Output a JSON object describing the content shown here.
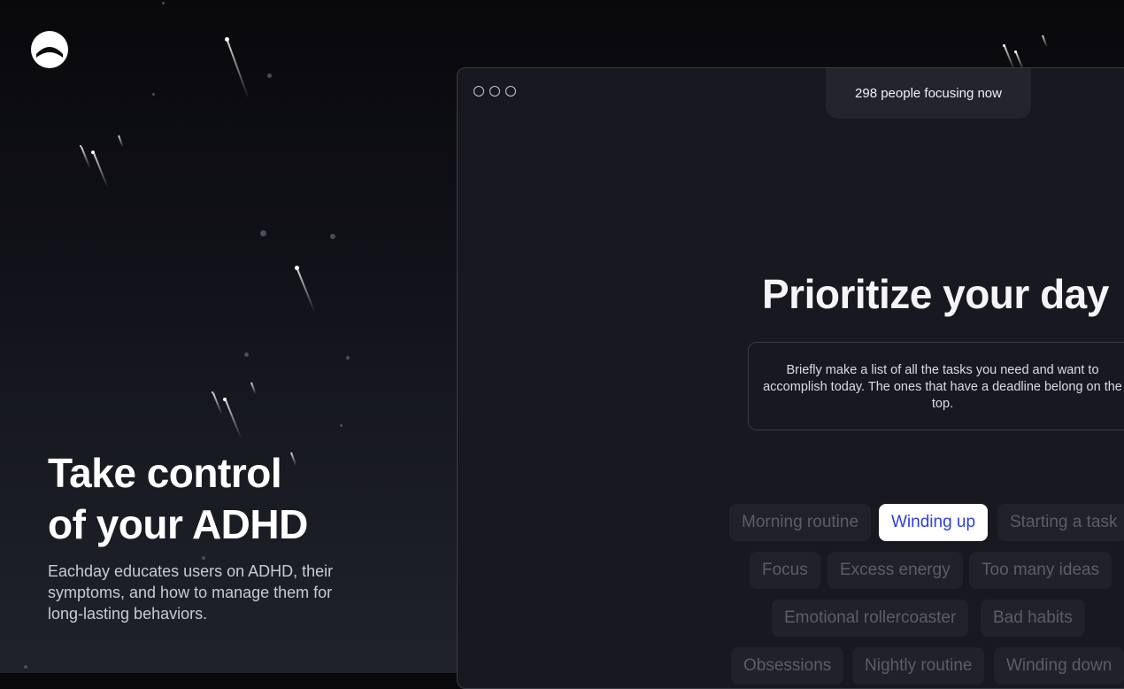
{
  "hero": {
    "title_line1": "Take control",
    "title_line2": "of your ADHD",
    "subtitle": "Eachday educates users on ADHD, their symptoms, and how to manage them for long-lasting behaviors."
  },
  "window": {
    "focus_status": "298 people focusing now",
    "section_title": "Prioritize your day",
    "description": "Briefly make a list of all the tasks you need and want to accomplish today. The ones that have a deadline belong on the top.",
    "chips_row1": [
      "Morning routine",
      "Winding up",
      "Starting a task"
    ],
    "chips_row2": [
      "Focus",
      "Excess energy",
      "Too many ideas"
    ],
    "chips_row3": [
      "Emotional rollercoaster",
      "Bad habits"
    ],
    "chips_row4": [
      "Obsessions",
      "Nightly routine",
      "Winding down"
    ],
    "selected_chip": "Winding up"
  },
  "colors": {
    "accent": "#2b3fe0",
    "background_top": "#09090c",
    "background_bottom": "#20222b"
  }
}
